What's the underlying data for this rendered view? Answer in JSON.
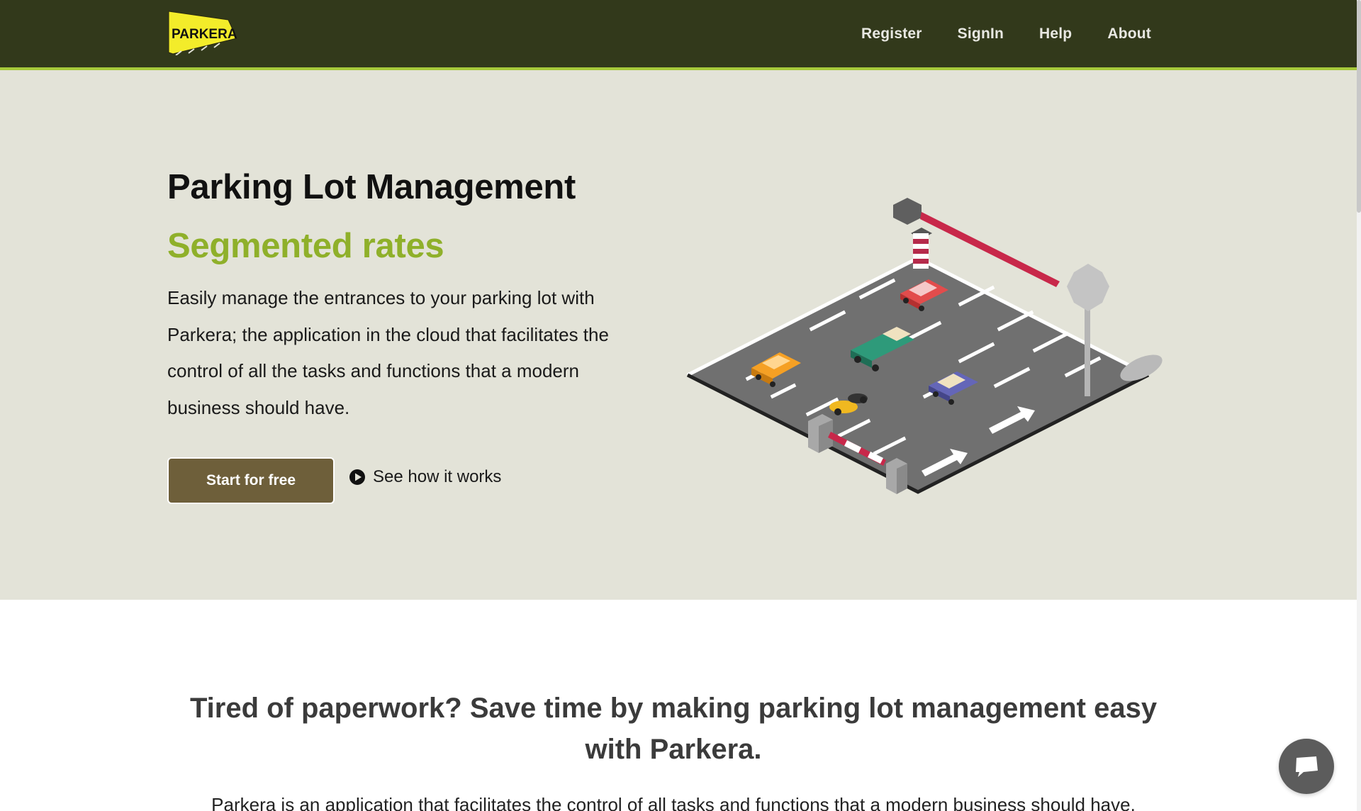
{
  "brand": {
    "logo_text": "PARKERA",
    "logo_color": "#f3ec2a",
    "header_color": "#32391b",
    "accent_color": "#a6c93a"
  },
  "nav": {
    "items": [
      {
        "label": "Register"
      },
      {
        "label": "SignIn"
      },
      {
        "label": "Help"
      },
      {
        "label": "About"
      }
    ]
  },
  "hero": {
    "title": "Parking Lot Management",
    "subtitle": "Segmented rates",
    "description": "Easily manage the entrances to your parking lot with Parkera; the application in the cloud that facilitates the control of all the tasks and functions that a modern business should have.",
    "cta_label": "Start for free",
    "cta_color": "#6e5f3a",
    "video_link_label": "See how it works",
    "video_icon": "play-circle-icon"
  },
  "section": {
    "title": "Tired of paperwork? Save time by making parking lot management easy with Parkera.",
    "text": "Parkera is an application that facilitates the control of all tasks and functions that a modern business should have."
  },
  "chat": {
    "icon": "chat-bubble-icon"
  }
}
